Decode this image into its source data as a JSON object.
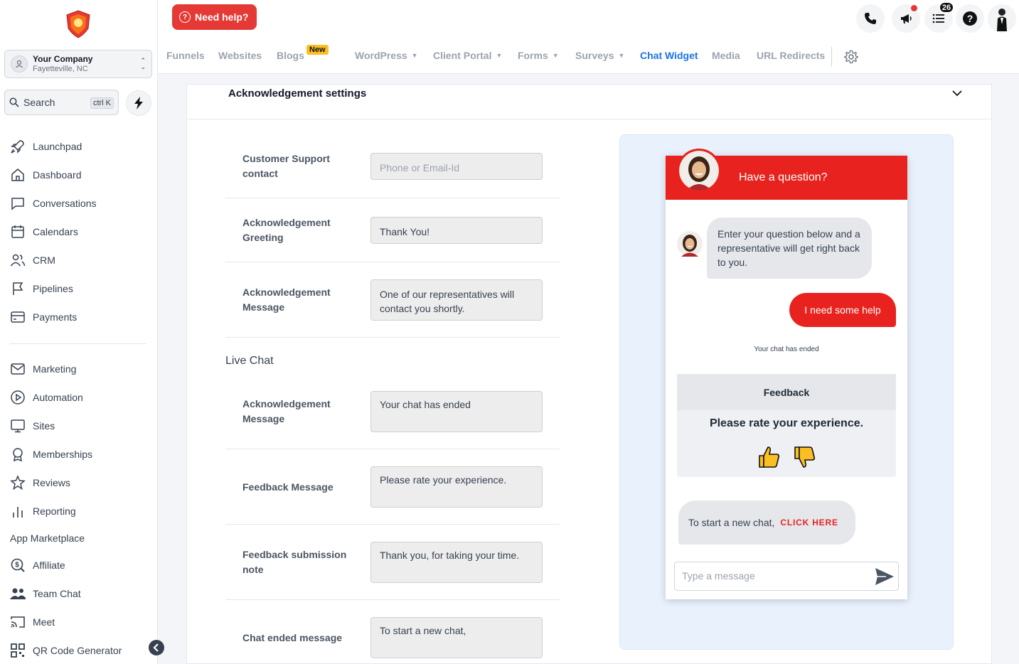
{
  "sidebar": {
    "company_name": "Your Company",
    "company_location": "Fayetteville, NC",
    "search_label": "Search",
    "search_shortcut": "ctrl K",
    "nav_main": [
      {
        "label": "Launchpad",
        "icon": "rocket-icon"
      },
      {
        "label": "Dashboard",
        "icon": "home-icon"
      },
      {
        "label": "Conversations",
        "icon": "chat-bubble-icon"
      },
      {
        "label": "Calendars",
        "icon": "calendar-icon"
      },
      {
        "label": "CRM",
        "icon": "users-icon"
      },
      {
        "label": "Pipelines",
        "icon": "flag-icon"
      },
      {
        "label": "Payments",
        "icon": "credit-card-icon"
      }
    ],
    "nav_secondary": [
      {
        "label": "Marketing",
        "icon": "mail-icon"
      },
      {
        "label": "Automation",
        "icon": "play-circle-icon"
      },
      {
        "label": "Sites",
        "icon": "monitor-icon"
      },
      {
        "label": "Memberships",
        "icon": "award-icon"
      },
      {
        "label": "Reviews",
        "icon": "star-icon"
      },
      {
        "label": "Reporting",
        "icon": "bar-chart-icon"
      }
    ],
    "app_marketplace": "App Marketplace",
    "nav_apps": [
      {
        "label": "Affiliate",
        "icon": "dollar-search-icon"
      },
      {
        "label": "Team Chat",
        "icon": "team-icon"
      },
      {
        "label": "Meet",
        "icon": "cast-icon"
      },
      {
        "label": "QR Code Generator",
        "icon": "qr-code-icon"
      }
    ]
  },
  "topbar": {
    "help_label": "Need help?",
    "notification_count": "26"
  },
  "tabs": [
    {
      "label": "Funnels",
      "dropdown": false
    },
    {
      "label": "Websites",
      "dropdown": false
    },
    {
      "label": "Blogs",
      "dropdown": false
    },
    {
      "label": "WordPress",
      "dropdown": true
    },
    {
      "label": "Client Portal",
      "dropdown": true
    },
    {
      "label": "Forms",
      "dropdown": true
    },
    {
      "label": "Surveys",
      "dropdown": true
    },
    {
      "label": "Chat Widget",
      "dropdown": false,
      "active": true
    },
    {
      "label": "Media",
      "dropdown": false
    },
    {
      "label": "URL Redirects",
      "dropdown": false
    }
  ],
  "new_badge": "New",
  "panel": {
    "title": "Acknowledgement settings",
    "live_chat_heading": "Live Chat",
    "fields": [
      {
        "label": "Customer Support contact",
        "value": "",
        "placeholder": "Phone or Email-Id"
      },
      {
        "label": "Acknowledgement Greeting",
        "value": "Thank You!"
      },
      {
        "label": "Acknowledgement Message",
        "value": "One of our representatives will contact you shortly."
      },
      {
        "label": "Acknowledgement Message",
        "value": "Your chat has ended"
      },
      {
        "label": "Feedback Message",
        "value": "Please rate your experience."
      },
      {
        "label": "Feedback submission note",
        "value": "Thank you, for taking your time."
      },
      {
        "label": "Chat ended message",
        "value": "To start a new chat,"
      }
    ]
  },
  "widget": {
    "header_title": "Have a question?",
    "bot_message": "Enter your question below and a representative will get right back to you.",
    "user_message": "I need some help",
    "chat_ended_note": "Your chat has ended",
    "feedback_title": "Feedback",
    "feedback_question": "Please rate your experience.",
    "new_chat_text": "To start a new chat,",
    "new_chat_link": "CLICK HERE",
    "input_placeholder": "Type a message"
  },
  "colors": {
    "accent_red": "#e8231f",
    "active_tab_blue": "#1a73e8",
    "preview_bg": "#e8f1fc"
  }
}
